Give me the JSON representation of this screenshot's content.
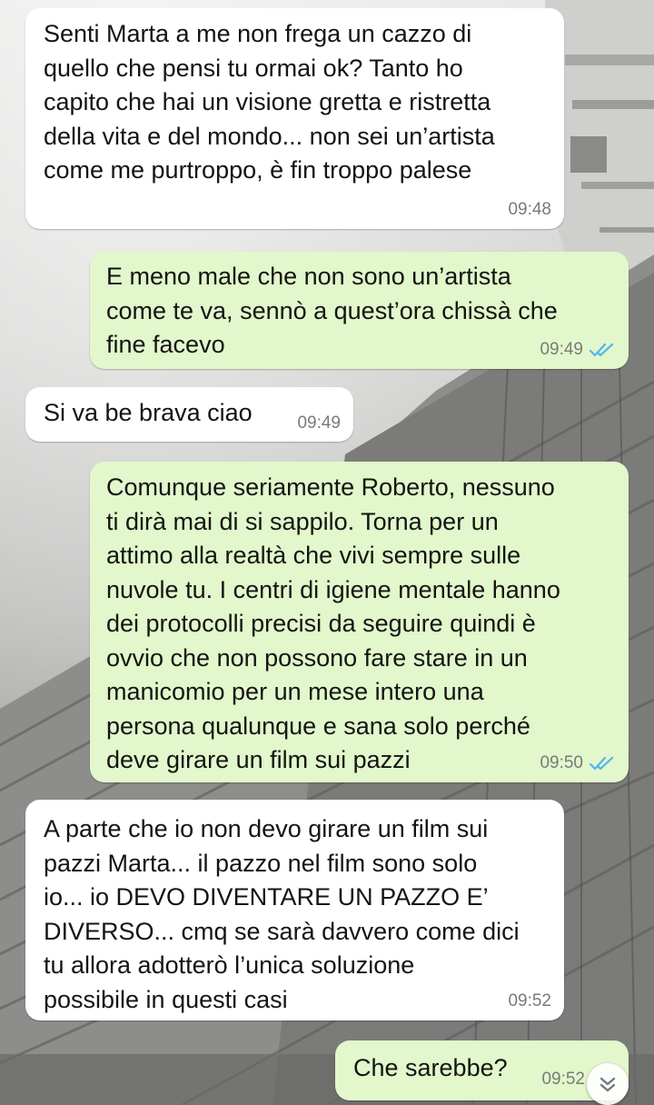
{
  "colors": {
    "incoming_bubble": "#ffffff",
    "outgoing_bubble": "#e2f7cb",
    "read_ticks": "#4fb6ec",
    "timestamp": "#7a7a7a"
  },
  "messages": [
    {
      "direction": "incoming",
      "text": "Senti Marta a me non frega un cazzo di\nquello che pensi tu ormai ok? Tanto ho\ncapito che hai un visione gretta e ristretta\ndella vita e del mondo... non sei un’artista\ncome me purtroppo, è fin troppo palese",
      "time": "09:48"
    },
    {
      "direction": "outgoing",
      "text": "E meno male che non sono un’artista\ncome te va, sennò a quest’ora chissà che\nfine facevo",
      "time": "09:49",
      "status": "read"
    },
    {
      "direction": "incoming",
      "text": "Si va be brava ciao",
      "time": "09:49"
    },
    {
      "direction": "outgoing",
      "text": "Comunque seriamente Roberto, nessuno\nti dirà mai di si sappilo. Torna per un\nattimo alla realtà che vivi sempre sulle\nnuvole tu. I centri di igiene mentale hanno\ndei protocolli precisi da seguire quindi è\novvio che non possono fare stare in un\nmanicomio per un mese intero una\npersona qualunque e sana solo perché\ndeve girare un film sui pazzi",
      "time": "09:50",
      "status": "read"
    },
    {
      "direction": "incoming",
      "text": "A parte che io non devo girare un film sui\npazzi Marta... il pazzo nel film sono solo\nio... io DEVO DIVENTARE UN PAZZO E’\nDIVERSO... cmq se sarà davvero come dici\ntu allora adotterò l’unica soluzione\npossibile in questi casi",
      "time": "09:52"
    },
    {
      "direction": "outgoing",
      "text": "Che sarebbe?",
      "time": "09:52",
      "status": "read"
    }
  ],
  "scroll_button": {
    "icon": "double-chevron-down-icon"
  }
}
